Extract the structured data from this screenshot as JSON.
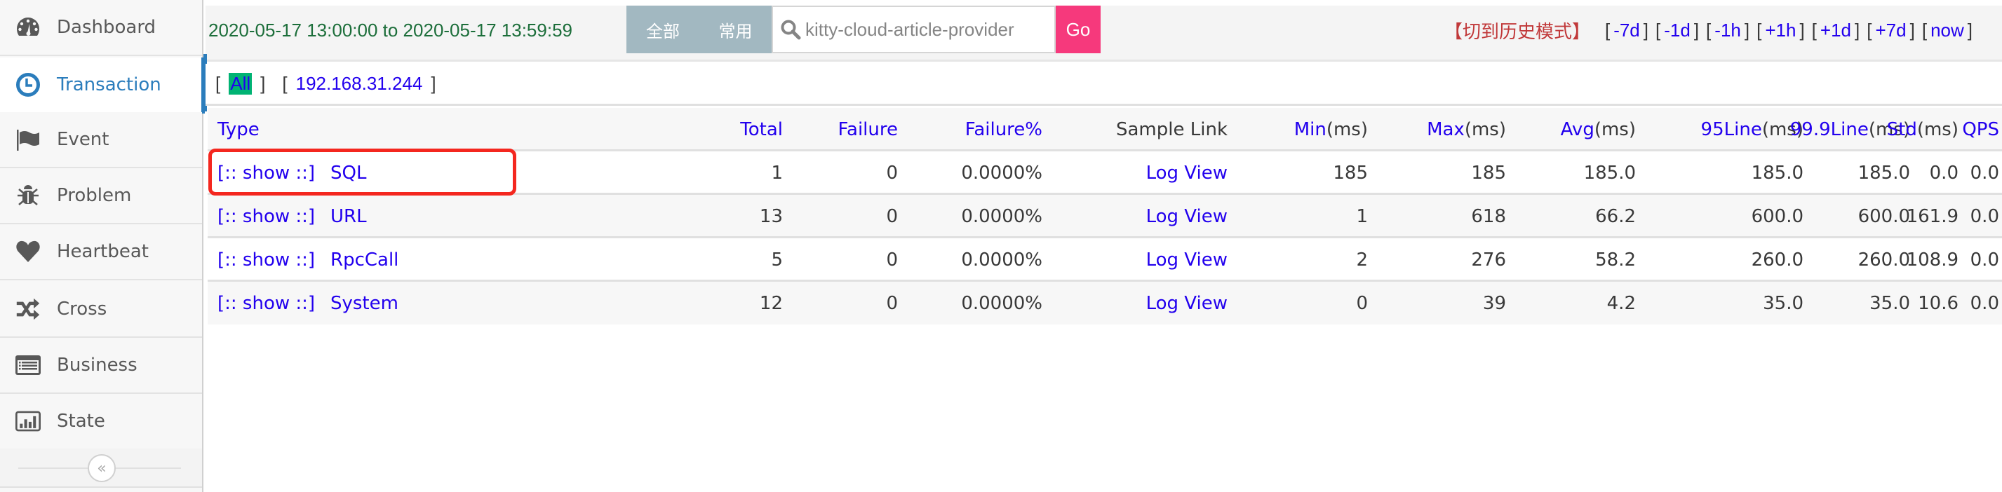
{
  "sidebar": {
    "items": [
      {
        "label": "Dashboard",
        "icon": "dashboard-icon",
        "active": false
      },
      {
        "label": "Transaction",
        "icon": "clock-icon",
        "active": true
      },
      {
        "label": "Event",
        "icon": "flag-icon",
        "active": false
      },
      {
        "label": "Problem",
        "icon": "bug-icon",
        "active": false
      },
      {
        "label": "Heartbeat",
        "icon": "heart-icon",
        "active": false
      },
      {
        "label": "Cross",
        "icon": "shuffle-icon",
        "active": false
      },
      {
        "label": "Business",
        "icon": "list-alt-icon",
        "active": false
      },
      {
        "label": "State",
        "icon": "bar-chart-icon",
        "active": false
      }
    ],
    "collapse_glyph": "«"
  },
  "topbar": {
    "time_range": "2020-05-17 13:00:00 to 2020-05-17 13:59:59",
    "btn_all": "全部",
    "btn_common": "常用",
    "search_value": "kitty-cloud-article-provider",
    "go_label": "Go",
    "history_mode": "【切到历史模式】",
    "time_links": [
      "-7d",
      "-1d",
      "-1h",
      "+1h",
      "+1d",
      "+7d",
      "now"
    ]
  },
  "ip_filter": {
    "all_label": "All",
    "ip": "192.168.31.244"
  },
  "table": {
    "headers": {
      "type": "Type",
      "total": "Total",
      "failure": "Failure",
      "failure_pct": "Failure%",
      "sample_link": "Sample Link",
      "min_a": "Min",
      "min_b": "(ms)",
      "max_a": "Max",
      "max_b": "(ms)",
      "avg_a": "Avg",
      "avg_b": "(ms)",
      "l95_a": "95Line",
      "l95_b": "(ms)",
      "l999_a": "99.9Line",
      "l999_b": "(ms)",
      "std_a": "Std",
      "std_b": "(ms)",
      "qps": "QPS"
    },
    "rows": [
      {
        "show": "[:: show ::]",
        "type": "SQL",
        "total": "1",
        "failure": "0",
        "failure_pct": "0.0000%",
        "sample": "Log View",
        "min": "185",
        "max": "185",
        "avg": "185.0",
        "l95": "185.0",
        "l999": "185.0",
        "std": "0.0",
        "qps": "0.0"
      },
      {
        "show": "[:: show ::]",
        "type": "URL",
        "total": "13",
        "failure": "0",
        "failure_pct": "0.0000%",
        "sample": "Log View",
        "min": "1",
        "max": "618",
        "avg": "66.2",
        "l95": "600.0",
        "l999": "600.0",
        "std": "161.9",
        "qps": "0.0"
      },
      {
        "show": "[:: show ::]",
        "type": "RpcCall",
        "total": "5",
        "failure": "0",
        "failure_pct": "0.0000%",
        "sample": "Log View",
        "min": "2",
        "max": "276",
        "avg": "58.2",
        "l95": "260.0",
        "l999": "260.0",
        "std": "108.9",
        "qps": "0.0"
      },
      {
        "show": "[:: show ::]",
        "type": "System",
        "total": "12",
        "failure": "0",
        "failure_pct": "0.0000%",
        "sample": "Log View",
        "min": "0",
        "max": "39",
        "avg": "4.2",
        "l95": "35.0",
        "l999": "35.0",
        "std": "10.6",
        "qps": "0.0"
      }
    ]
  },
  "colors": {
    "accent": "#2b7dbc",
    "link": "#2200ee",
    "time_range": "#1c6e3a",
    "go_button": "#f6397c",
    "segment_button": "#a2b8c1",
    "history_mode": "#c1393a",
    "ip_all_bg": "#00b373",
    "highlight": "#f4271f"
  }
}
